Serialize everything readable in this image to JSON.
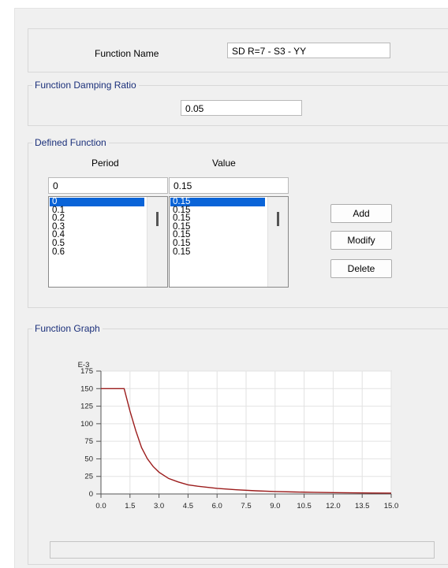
{
  "function_name": {
    "label": "Function Name",
    "value": "SD R=7 - S3 - YY"
  },
  "damping": {
    "legend": "Function Damping Ratio",
    "value": "0.05"
  },
  "defined_function": {
    "legend": "Defined Function",
    "period_header": "Period",
    "value_header": "Value",
    "period_input": "0",
    "value_input": "0.15",
    "periods": [
      "0",
      "0.1",
      "0.2",
      "0.3",
      "0.4",
      "0.5",
      "0.6"
    ],
    "values": [
      "0.15",
      "0.15",
      "0.15",
      "0.15",
      "0.15",
      "0.15",
      "0.15"
    ],
    "selected_index": 0,
    "buttons": {
      "add": "Add",
      "modify": "Modify",
      "delete": "Delete"
    }
  },
  "graph": {
    "legend": "Function Graph",
    "status_text": ""
  },
  "chart_data": {
    "type": "line",
    "title": "",
    "xlabel": "",
    "ylabel": "",
    "y_multiplier_label": "E-3",
    "xlim": [
      0,
      15
    ],
    "ylim": [
      0,
      175
    ],
    "x_ticks": [
      "0.0",
      "1.5",
      "3.0",
      "4.5",
      "6.0",
      "7.5",
      "9.0",
      "10.5",
      "12.0",
      "13.5",
      "15.0"
    ],
    "y_ticks": [
      "175",
      "150",
      "125",
      "100",
      "75",
      "50",
      "25",
      "0"
    ],
    "grid": true,
    "line_color": "#9b1b1b",
    "series": [
      {
        "x": [
          0,
          1.2,
          1.5,
          1.8,
          2.1,
          2.4,
          2.7,
          3.0,
          3.5,
          4.0,
          4.5,
          5.0,
          6.0,
          7.0,
          8.0,
          9.0,
          10.0,
          11.0,
          12.0,
          13.0,
          14.0,
          15.0
        ],
        "values": [
          150,
          150,
          118,
          90,
          66,
          50,
          39,
          31,
          22,
          17,
          13,
          11,
          8,
          6,
          4.5,
          3.5,
          2.8,
          2.3,
          1.9,
          1.6,
          1.4,
          1.2
        ]
      }
    ]
  }
}
